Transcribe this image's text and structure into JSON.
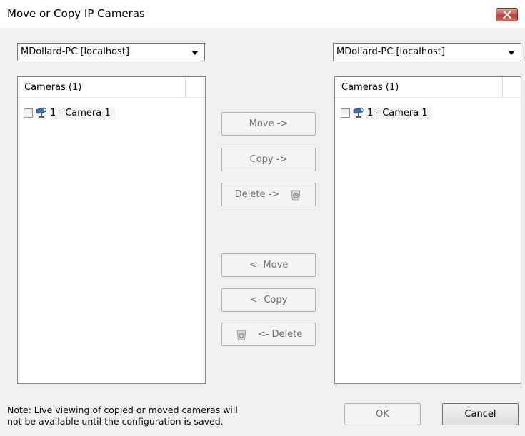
{
  "window": {
    "title": "Move or Copy IP Cameras"
  },
  "left": {
    "server": "MDollard-PC [localhost]",
    "header": "Cameras (1)",
    "cameras": [
      {
        "label": "1 - Camera 1"
      }
    ]
  },
  "right": {
    "server": "MDollard-PC [localhost]",
    "header": "Cameras (1)",
    "cameras": [
      {
        "label": "1 - Camera 1"
      }
    ]
  },
  "actions": {
    "move_right": "Move ->",
    "copy_right": "Copy ->",
    "delete_right": "Delete ->",
    "move_left": "<- Move",
    "copy_left": "<- Copy",
    "delete_left": "<- Delete"
  },
  "note": {
    "line1": "Note: Live viewing of copied or moved cameras will",
    "line2": "not be available until the configuration is saved."
  },
  "footer": {
    "ok": "OK",
    "cancel": "Cancel"
  },
  "colors": {
    "dialog_bg": "#f0f0f0",
    "close_button": "#c75050",
    "disabled_text": "#6d6d6d"
  }
}
